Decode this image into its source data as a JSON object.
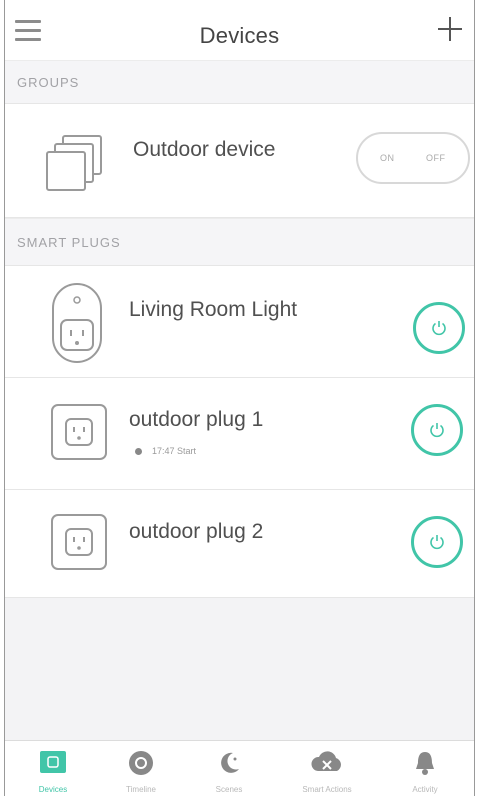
{
  "header": {
    "title": "Devices",
    "menu_icon": "hamburger-icon",
    "add_icon": "plus-icon"
  },
  "groups": {
    "section_label": "GROUPS",
    "items": [
      {
        "name": "Outdoor device",
        "icon": "group-stack-icon",
        "on_label": "ON",
        "off_label": "OFF"
      }
    ]
  },
  "smart_plugs": {
    "section_label": "SMART PLUGS",
    "items": [
      {
        "name": "Living Room Light",
        "icon": "smart-plug-icon",
        "power_state": "off"
      },
      {
        "name": "outdoor plug 1",
        "icon": "outdoor-plug-icon",
        "schedule": "17:47 Start",
        "power_state": "off"
      },
      {
        "name": "outdoor plug 2",
        "icon": "outdoor-plug-icon",
        "power_state": "off"
      }
    ]
  },
  "tabbar": {
    "tabs": [
      {
        "label": "Devices",
        "icon": "devices-icon",
        "active": true
      },
      {
        "label": "Timeline",
        "icon": "timeline-icon",
        "active": false
      },
      {
        "label": "Scenes",
        "icon": "scenes-icon",
        "active": false
      },
      {
        "label": "Smart Actions",
        "icon": "smart-actions-icon",
        "active": false
      },
      {
        "label": "Activity",
        "icon": "activity-bell-icon",
        "active": false
      }
    ]
  },
  "colors": {
    "accent": "#41c5a8",
    "background": "#f3f3f5",
    "divider": "#e6e6e6",
    "text": "#505050",
    "muted": "#a2a2a6"
  }
}
